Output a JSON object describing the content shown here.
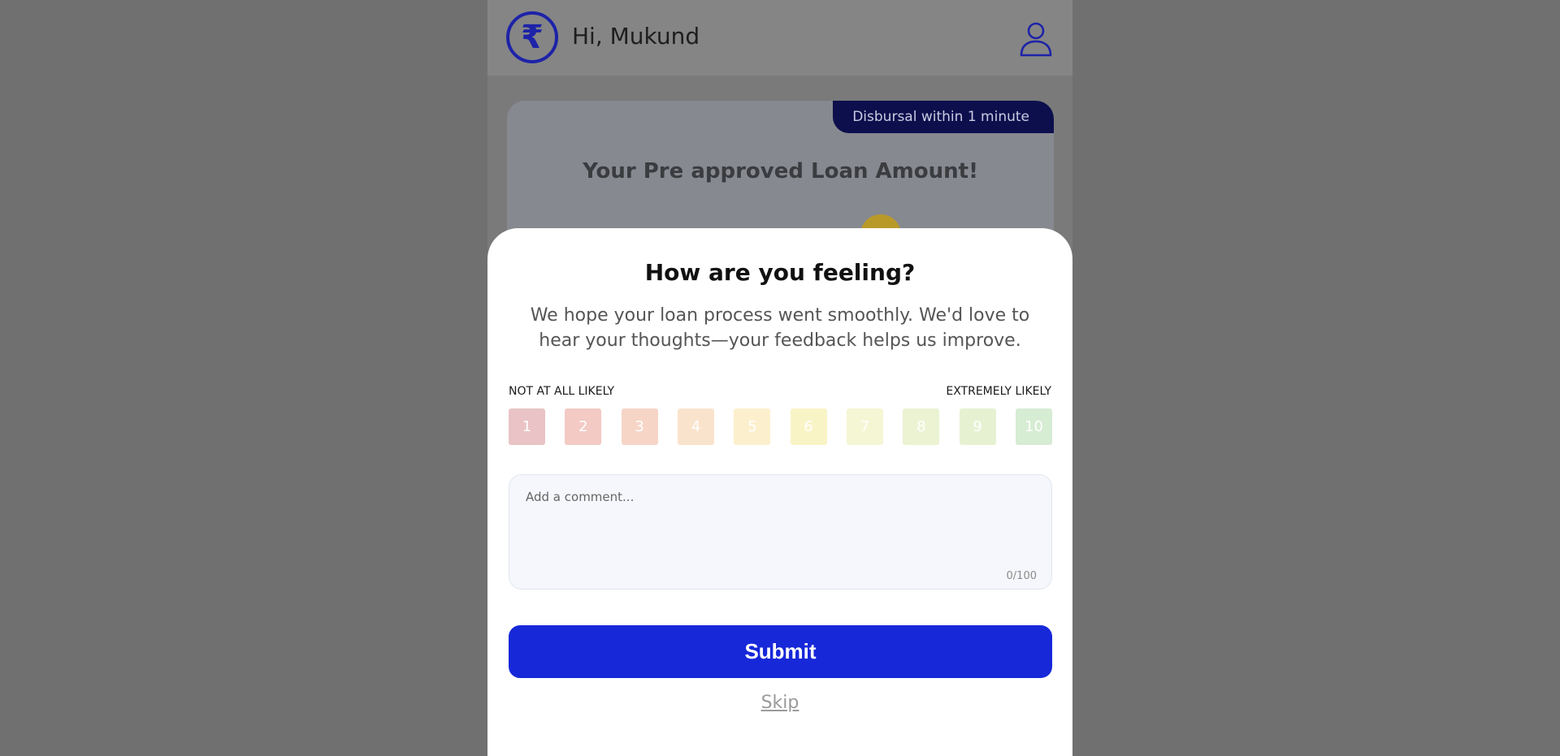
{
  "header": {
    "greeting": "Hi, Mukund",
    "logo_symbol": "₹",
    "logo_icon": "rupee-icon",
    "profile_icon": "user-icon"
  },
  "card": {
    "badge": "Disbursal within 1 minute",
    "title": "Your Pre approved Loan Amount!"
  },
  "feedback": {
    "title": "How are you feeling?",
    "subtitle": "We hope your loan process went smoothly. We'd love to hear your thoughts—your feedback helps us improve.",
    "scale_min_label": "NOT AT ALL LIKELY",
    "scale_max_label": "EXTREMELY LIKELY",
    "scores": [
      {
        "label": "1",
        "color": "#e9c3c5"
      },
      {
        "label": "2",
        "color": "#f3cac4"
      },
      {
        "label": "3",
        "color": "#f6d5c7"
      },
      {
        "label": "4",
        "color": "#fae3cc"
      },
      {
        "label": "5",
        "color": "#fcefcd"
      },
      {
        "label": "6",
        "color": "#f9f4c6"
      },
      {
        "label": "7",
        "color": "#f5f6d4"
      },
      {
        "label": "8",
        "color": "#ebf3d2"
      },
      {
        "label": "9",
        "color": "#e6f1d2"
      },
      {
        "label": "10",
        "color": "#d6ecd3"
      }
    ],
    "comment_placeholder": "Add a comment...",
    "comment_counter": "0/100",
    "submit_label": "Submit",
    "skip_label": "Skip"
  }
}
